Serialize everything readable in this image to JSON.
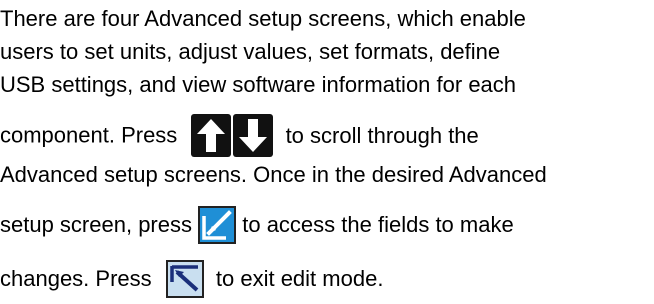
{
  "paragraph": {
    "line1": "There are four Advanced setup screens, which enable",
    "line2": "users to set units, adjust values, set formats, define",
    "line3": "USB settings, and view software information for each",
    "line4_before": "component. Press",
    "line4_after": "to scroll through the",
    "line5": "Advanced setup screens. Once in the desired Advanced",
    "line6_before": "setup screen, press",
    "line6_after": "to access the fields to make",
    "line7_before": "changes. Press",
    "line7_after": "to exit edit mode."
  },
  "icons": {
    "up": "up-arrow-icon",
    "down": "down-arrow-icon",
    "edit": "edit-icon",
    "exit": "exit-edit-icon"
  },
  "colors": {
    "text": "#000000",
    "arrow_key_bg": "#111111",
    "edit_icon_bg": "#1f8fd6",
    "exit_icon_bg": "#c9dff0",
    "icon_border": "#222222"
  }
}
